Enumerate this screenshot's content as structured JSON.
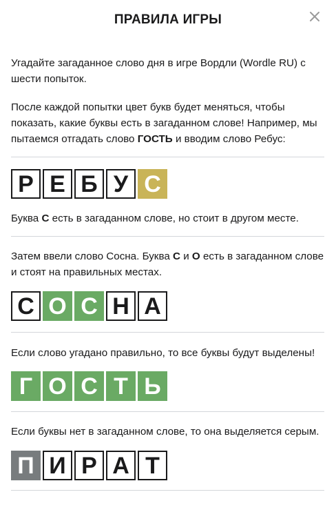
{
  "modal": {
    "title": "ПРАВИЛА ИГРЫ",
    "close_icon": "close-icon"
  },
  "intro": {
    "line1": "Угадайте загаданное слово дня в игре Вордли (Wordle RU) с шести попыток.",
    "line2_pre": "После каждой попытки цвет букв будет меняться, чтобы показать, какие буквы есть в загаданном слове! Например, мы пытаемся отгадать слово ",
    "line2_bold": "ГОСТЬ",
    "line2_post": " и вводим слово Ребус:"
  },
  "examples": {
    "rebus": {
      "tiles": [
        {
          "letter": "Р",
          "state": "empty"
        },
        {
          "letter": "Е",
          "state": "empty"
        },
        {
          "letter": "Б",
          "state": "empty"
        },
        {
          "letter": "У",
          "state": "empty"
        },
        {
          "letter": "С",
          "state": "present"
        }
      ],
      "caption_pre": "Буква ",
      "caption_bold": "С",
      "caption_post": " есть в загаданном слове, но стоит в другом месте."
    },
    "sosna": {
      "intro_pre": "Затем ввели слово Сосна. Буква ",
      "intro_bold1": "С",
      "intro_mid": " и ",
      "intro_bold2": "О",
      "intro_post": " есть в загаданном слове и стоят на правильных местах.",
      "tiles": [
        {
          "letter": "С",
          "state": "empty"
        },
        {
          "letter": "О",
          "state": "correct"
        },
        {
          "letter": "С",
          "state": "correct"
        },
        {
          "letter": "Н",
          "state": "empty"
        },
        {
          "letter": "А",
          "state": "empty"
        }
      ]
    },
    "gost": {
      "intro": "Если слово угадано правильно, то все буквы будут выделены!",
      "tiles": [
        {
          "letter": "Г",
          "state": "correct"
        },
        {
          "letter": "О",
          "state": "correct"
        },
        {
          "letter": "С",
          "state": "correct"
        },
        {
          "letter": "Т",
          "state": "correct"
        },
        {
          "letter": "Ь",
          "state": "correct"
        }
      ]
    },
    "pirat": {
      "intro": "Если буквы нет в загаданном слове, то она выделяется серым.",
      "tiles": [
        {
          "letter": "П",
          "state": "absent"
        },
        {
          "letter": "И",
          "state": "empty"
        },
        {
          "letter": "Р",
          "state": "empty"
        },
        {
          "letter": "А",
          "state": "empty"
        },
        {
          "letter": "Т",
          "state": "empty"
        }
      ]
    }
  },
  "colors": {
    "correct": "#6aaa64",
    "present": "#c9b458",
    "absent": "#787c7e",
    "border": "#1a1a1b",
    "divider": "#d3d6da"
  }
}
